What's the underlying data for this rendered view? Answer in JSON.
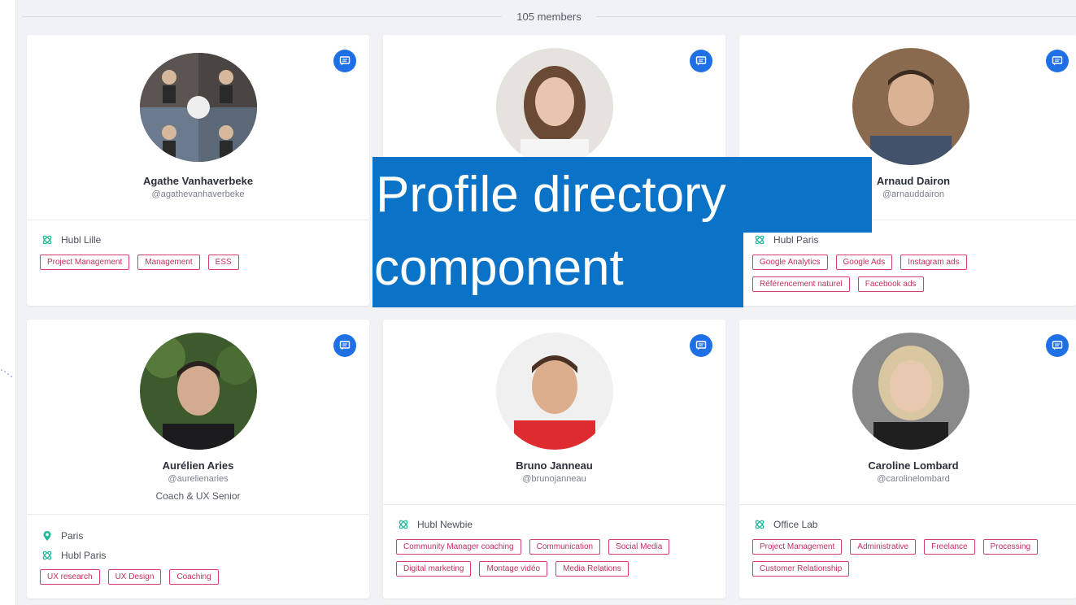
{
  "header": {
    "members_count": "105 members"
  },
  "overlay": {
    "line1": "Profile directory",
    "line2": "component"
  },
  "cards": [
    {
      "name": "Agathe Vanhaverbeke",
      "handle": "@agathevanhaverbeke",
      "hub": "Hubl Lille",
      "tags": [
        "Project Management",
        "Management",
        "ESS"
      ]
    },
    {
      "name": "",
      "handle": "",
      "hub": "",
      "tags": []
    },
    {
      "name": "Arnaud Dairon",
      "handle": "@arnauddairon",
      "hub": "Hubl Paris",
      "tags": [
        "Google Analytics",
        "Google Ads",
        "Instagram ads",
        "Référencement naturel",
        "Facebook ads"
      ]
    },
    {
      "name": "Aurélien Aries",
      "handle": "@aurelienaries",
      "role": "Coach & UX Senior",
      "location": "Paris",
      "hub": "Hubl Paris",
      "tags": [
        "UX research",
        "UX Design",
        "Coaching"
      ]
    },
    {
      "name": "Bruno Janneau",
      "handle": "@brunojanneau",
      "hub": "Hubl Newbie",
      "tags": [
        "Community Manager coaching",
        "Communication",
        "Social Media",
        "Digital marketing",
        "Montage vidéo",
        "Media Relations"
      ]
    },
    {
      "name": "Caroline Lombard",
      "handle": "@carolinelombard",
      "hub": "Office Lab",
      "tags": [
        "Project Management",
        "Administrative",
        "Freelance",
        "Processing",
        "Customer Relationship"
      ]
    }
  ]
}
